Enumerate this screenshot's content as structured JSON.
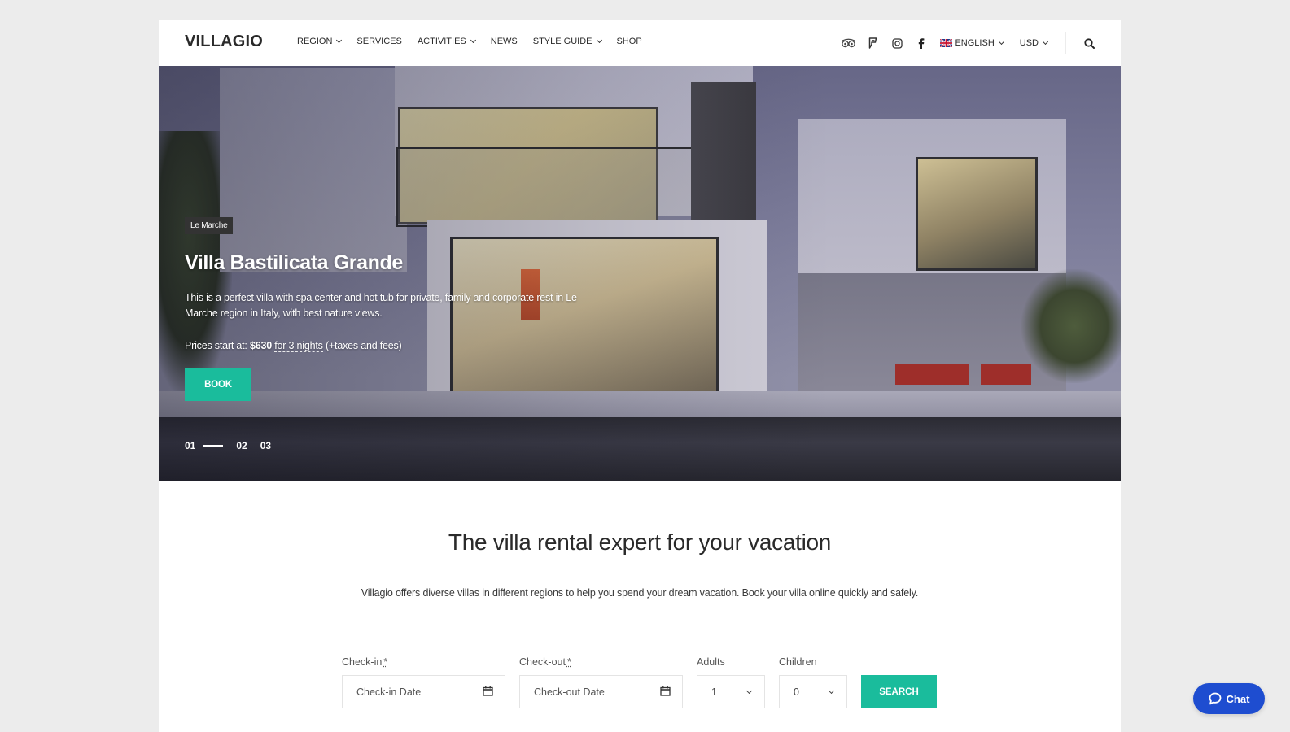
{
  "header": {
    "logo": "VILLAGIO",
    "nav": [
      {
        "label": "REGION",
        "has_dropdown": true
      },
      {
        "label": "SERVICES",
        "has_dropdown": false
      },
      {
        "label": "ACTIVITIES",
        "has_dropdown": true
      },
      {
        "label": "NEWS",
        "has_dropdown": false
      },
      {
        "label": "STYLE GUIDE",
        "has_dropdown": true
      },
      {
        "label": "SHOP",
        "has_dropdown": false
      }
    ],
    "social_icons": [
      "tripadvisor-icon",
      "foursquare-icon",
      "instagram-icon",
      "facebook-icon"
    ],
    "language": "ENGLISH",
    "currency": "USD",
    "search_icon": "search-icon"
  },
  "hero": {
    "tag": "Le Marche",
    "title": "Villa Bastilicata Grande",
    "description": "This is a perfect villa with spa center and hot tub for private, family and corporate rest in Le Marche region in Italy, with best nature views.",
    "price_prefix": "Prices start at:",
    "price": "$630",
    "price_period": "for 3 nights",
    "price_suffix": "(+taxes and fees)",
    "book_label": "BOOK",
    "slides": [
      "01",
      "02",
      "03"
    ],
    "active_slide": "01"
  },
  "main": {
    "title": "The villa rental expert for your vacation",
    "description": "Villagio offers diverse  villas in different regions to help you spend your dream vacation. Book your villa online quickly and safely."
  },
  "search_form": {
    "checkin_label": "Check-in",
    "checkin_placeholder": "Check-in Date",
    "checkout_label": "Check-out",
    "checkout_placeholder": "Check-out Date",
    "required_mark": "*",
    "adults_label": "Adults",
    "adults_value": "1",
    "children_label": "Children",
    "children_value": "0",
    "search_label": "SEARCH"
  },
  "chat": {
    "label": "Chat"
  },
  "colors": {
    "accent": "#1abc9c",
    "chat": "#1e4dd0",
    "tag_bg": "#333333",
    "page_bg": "#ececec"
  }
}
